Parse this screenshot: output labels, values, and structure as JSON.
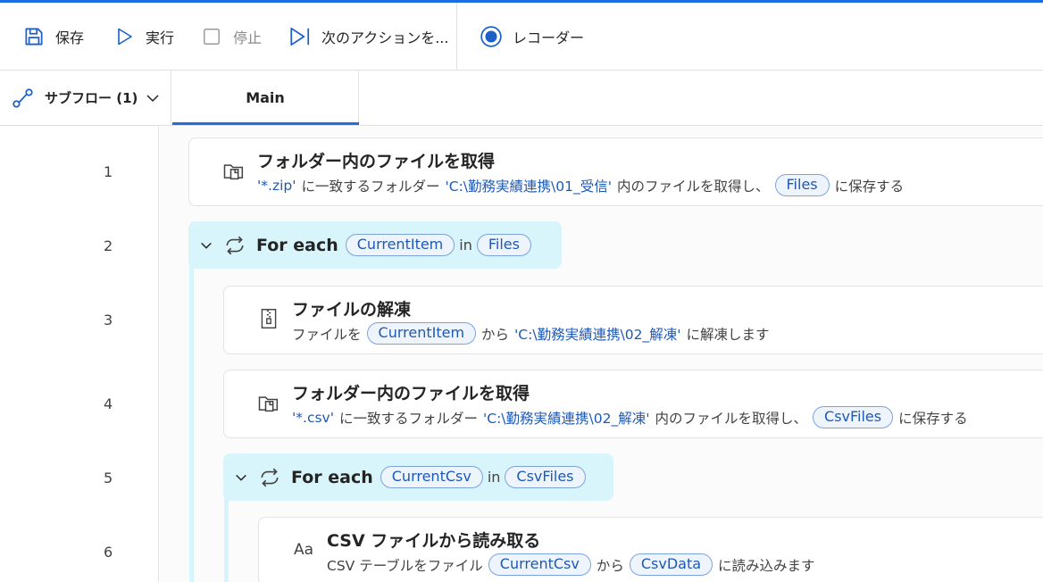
{
  "toolbar": {
    "save_label": "保存",
    "run_label": "実行",
    "stop_label": "停止",
    "next_label": "次のアクションを...",
    "recorder_label": "レコーダー"
  },
  "tabs": {
    "subflow_label": "サブフロー (1)",
    "main_label": "Main"
  },
  "line_numbers": [
    "1",
    "2",
    "3",
    "4",
    "5",
    "6"
  ],
  "steps": {
    "s1": {
      "title": "フォルダー内のファイルを取得",
      "pattern": "'*.zip'",
      "t1": "に一致するフォルダー",
      "folder": "'C:\\勤務実績連携\\01_受信'",
      "t2": "内のファイルを取得し、",
      "var": "Files",
      "t3": "に保存する"
    },
    "s2": {
      "keyword": "For each",
      "item_var": "CurrentItem",
      "in_label": "in",
      "list_var": "Files"
    },
    "s3": {
      "title": "ファイルの解凍",
      "t1": "ファイルを",
      "var": "CurrentItem",
      "t2": "から",
      "folder": "'C:\\勤務実績連携\\02_解凍'",
      "t3": "に解凍します"
    },
    "s4": {
      "title": "フォルダー内のファイルを取得",
      "pattern": "'*.csv'",
      "t1": "に一致するフォルダー",
      "folder": "'C:\\勤務実績連携\\02_解凍'",
      "t2": "内のファイルを取得し、",
      "var": "CsvFiles",
      "t3": "に保存する"
    },
    "s5": {
      "keyword": "For each",
      "item_var": "CurrentCsv",
      "in_label": "in",
      "list_var": "CsvFiles"
    },
    "s6": {
      "title": "CSV ファイルから読み取る",
      "t1": "CSV テーブルをファイル",
      "var": "CurrentCsv",
      "t2": "から",
      "var2": "CsvData",
      "t3": "に読み込みます",
      "icon_text": "Aa"
    }
  },
  "colors": {
    "accent": "#1b6fe0",
    "loop_bg": "#d7f5fb",
    "string_value": "#1e59b5",
    "pill_border": "#7da3df"
  },
  "icons": [
    "save-icon",
    "play-icon",
    "stop-checkbox-icon",
    "step-next-icon",
    "record-icon",
    "subflow-icon",
    "chevron-down-icon",
    "folder-files-icon",
    "loop-icon",
    "zip-icon",
    "text-aa-icon"
  ]
}
